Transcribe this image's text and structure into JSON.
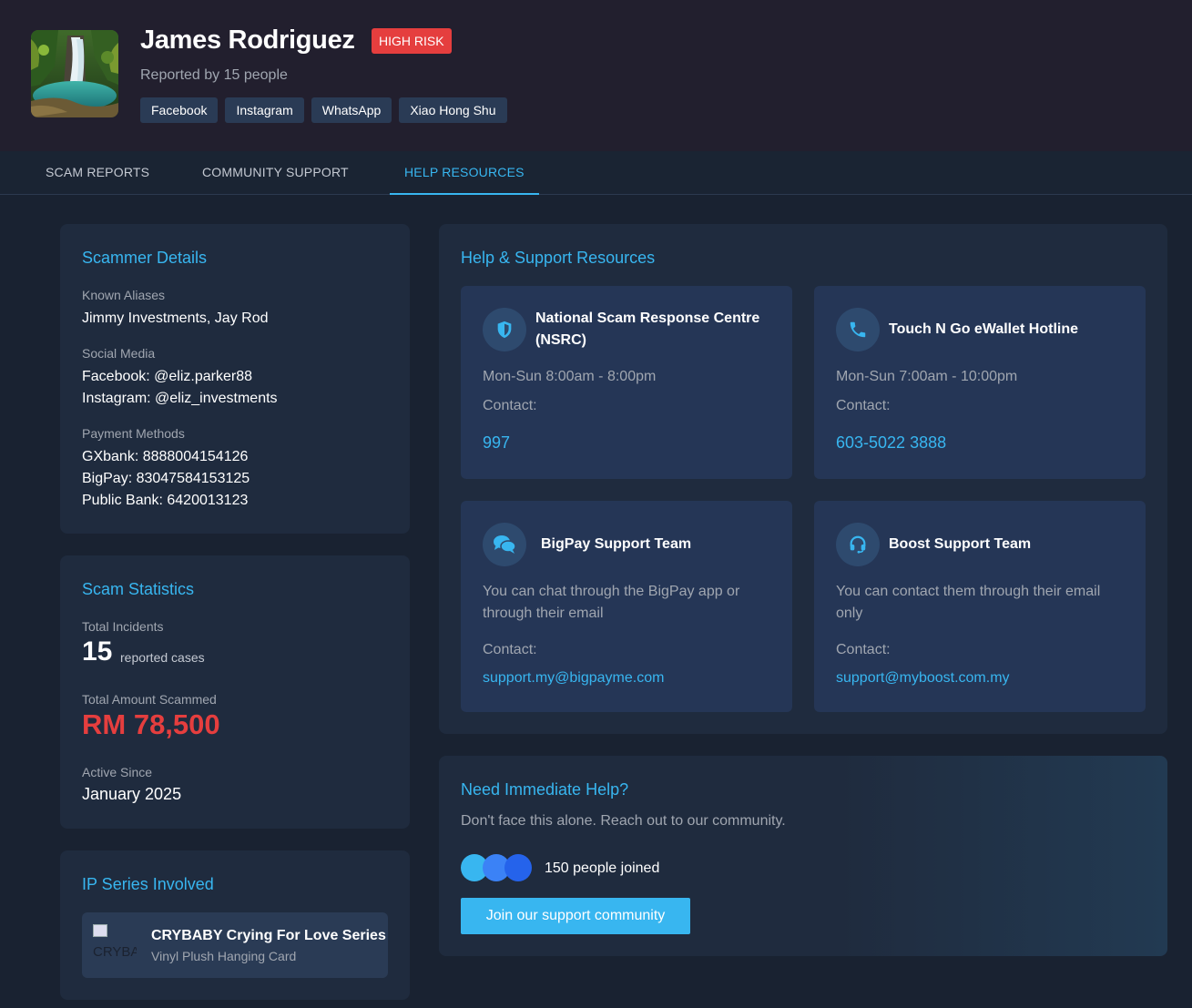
{
  "profile": {
    "name": "James Rodriguez",
    "risk_badge": "HIGH RISK",
    "reported_by": "Reported by 15 people",
    "platforms": [
      "Facebook",
      "Instagram",
      "WhatsApp",
      "Xiao Hong Shu"
    ]
  },
  "tabs": [
    {
      "label": "SCAM REPORTS",
      "active": false
    },
    {
      "label": "COMMUNITY SUPPORT",
      "active": false
    },
    {
      "label": "HELP RESOURCES",
      "active": true
    }
  ],
  "scammer_details": {
    "title": "Scammer Details",
    "aliases_label": "Known Aliases",
    "aliases": "Jimmy Investments, Jay Rod",
    "social_label": "Social Media",
    "social": [
      "Facebook: @eliz.parker88",
      "Instagram: @eliz_investments"
    ],
    "payment_label": "Payment Methods",
    "payments": [
      "GXbank: 8888004154126",
      "BigPay: 83047584153125",
      "Public Bank: 6420013123"
    ]
  },
  "scam_statistics": {
    "title": "Scam Statistics",
    "incidents_label": "Total Incidents",
    "incidents_value": "15",
    "incidents_suffix": "reported cases",
    "amount_label": "Total Amount Scammed",
    "amount_value": "RM 78,500",
    "active_label": "Active Since",
    "active_value": "January 2025"
  },
  "ip_series": {
    "title": "IP Series Involved",
    "item_img_alt": "CRYBABY Crying",
    "item_name": "CRYBABY Crying For Love Series",
    "item_sub": "Vinyl Plush Hanging Card"
  },
  "help_resources": {
    "title": "Help & Support Resources",
    "cards": [
      {
        "icon": "shield-icon",
        "title": "National Scam Response Centre (NSRC)",
        "text": "Mon-Sun 8:00am - 8:00pm",
        "contact_label": "Contact:",
        "contact": "997"
      },
      {
        "icon": "phone-icon",
        "title": "Touch N Go eWallet Hotline",
        "text": "Mon-Sun 7:00am - 10:00pm",
        "contact_label": "Contact:",
        "contact": "603-5022 3888"
      },
      {
        "icon": "chat-icon",
        "title": "BigPay Support Team",
        "text": "You can chat through the BigPay app or through their email",
        "contact_label": "Contact:",
        "contact": "support.my@bigpayme.com"
      },
      {
        "icon": "headset-icon",
        "title": "Boost Support Team",
        "text": "You can contact them through their email only",
        "contact_label": "Contact:",
        "contact": "support@myboost.com.my"
      }
    ]
  },
  "immediate_help": {
    "title": "Need Immediate Help?",
    "subtitle": "Don't face this alone. Reach out to our community.",
    "joined": "150 people joined",
    "button": "Join our support community"
  },
  "colors": {
    "accent": "#38b6f0",
    "danger": "#e53e3e",
    "background": "#192231",
    "card": "#1f2b3e"
  }
}
